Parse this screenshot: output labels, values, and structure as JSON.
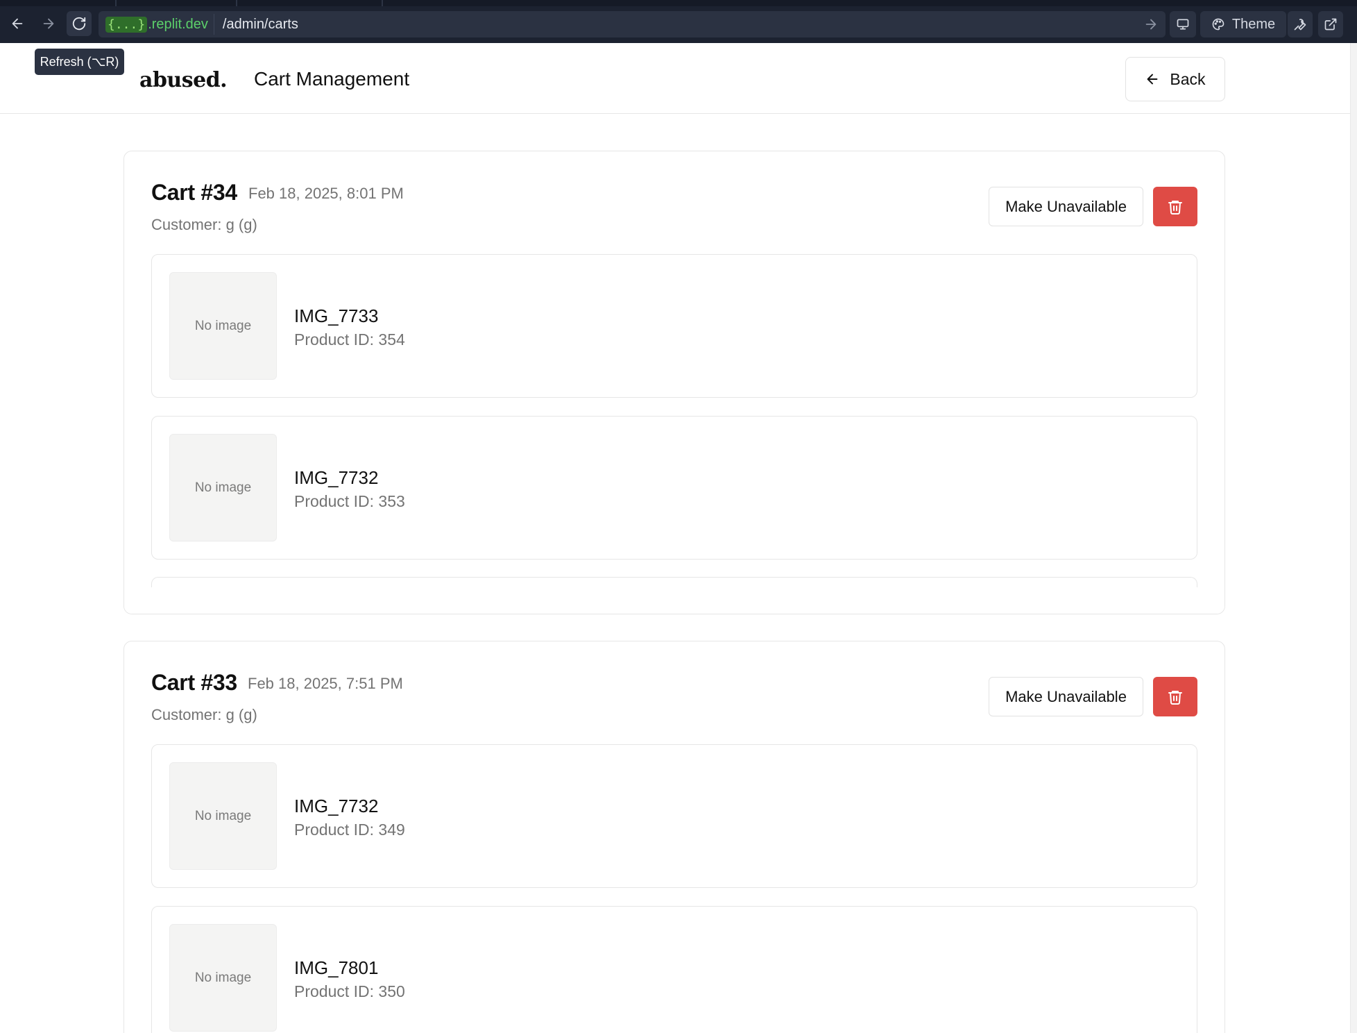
{
  "browser": {
    "url_host_tag": "{...}",
    "url_host": ".replit.dev",
    "url_path": "/admin/carts",
    "theme_label": "Theme",
    "tooltip": "Refresh (⌥R)"
  },
  "header": {
    "logo": "abused.",
    "title": "Cart Management",
    "back_label": "Back"
  },
  "carts": [
    {
      "title": "Cart #34",
      "date": "Feb 18, 2025, 8:01 PM",
      "customer": "Customer: g (g)",
      "make_unavailable_label": "Make Unavailable",
      "items": [
        {
          "placeholder": "No image",
          "name": "IMG_7733",
          "product_id": "Product ID: 354"
        },
        {
          "placeholder": "No image",
          "name": "IMG_7732",
          "product_id": "Product ID: 353"
        }
      ]
    },
    {
      "title": "Cart #33",
      "date": "Feb 18, 2025, 7:51 PM",
      "customer": "Customer: g (g)",
      "make_unavailable_label": "Make Unavailable",
      "items": [
        {
          "placeholder": "No image",
          "name": "IMG_7732",
          "product_id": "Product ID: 349"
        },
        {
          "placeholder": "No image",
          "name": "IMG_7801",
          "product_id": "Product ID: 350"
        }
      ]
    }
  ],
  "colors": {
    "chrome_bg": "#1c2230",
    "delete_red": "#df4b45",
    "muted_text": "#737373",
    "border": "#e6e6e6"
  },
  "icons": {
    "nav_back": "arrow-left-icon",
    "nav_forward": "arrow-right-icon",
    "refresh": "refresh-icon",
    "go": "arrow-right-icon",
    "devtools": "monitor-icon",
    "theme": "palette-icon",
    "tools": "wrench-icon",
    "open_external": "external-link-icon",
    "back": "arrow-left-icon",
    "delete": "trash-icon"
  }
}
